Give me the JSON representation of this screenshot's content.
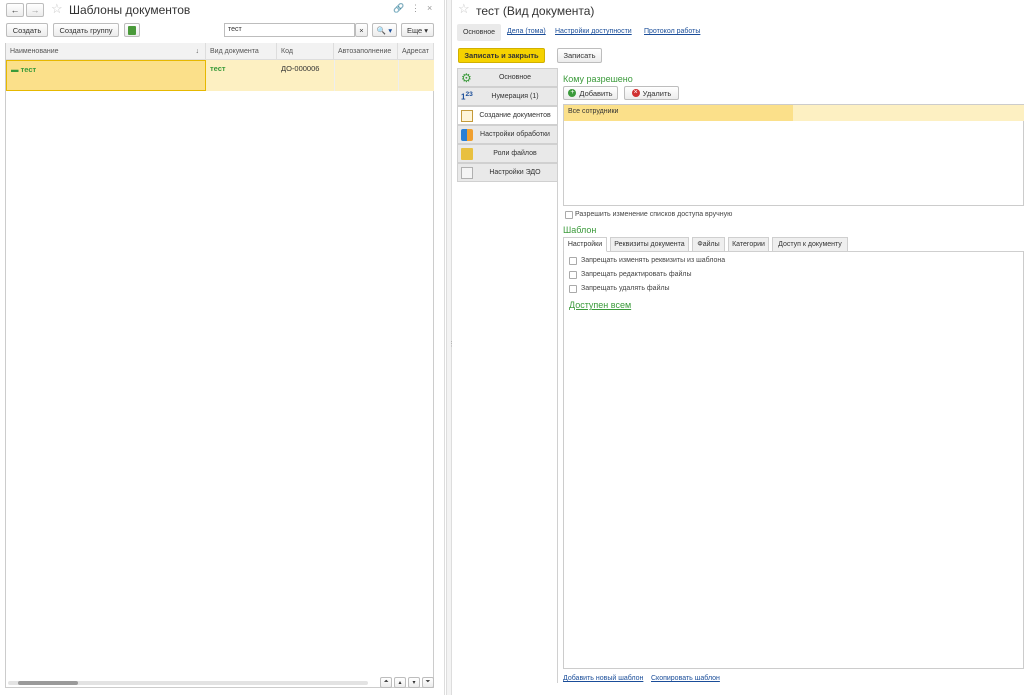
{
  "left": {
    "title": "Шаблоны документов",
    "toolbar": {
      "create": "Создать",
      "create_group": "Создать группу",
      "search_value": "тест",
      "search_clear": "×",
      "search_btn": "🔍 ▾",
      "more": "Еще ▾"
    },
    "table": {
      "columns": [
        "Наименование",
        "Вид документа",
        "Код",
        "Автозаполнение",
        "Адресат"
      ],
      "sort_mark": "↓",
      "rows": [
        {
          "name": "тест",
          "doc_type": "тест",
          "code": "ДО-000006",
          "auto": "",
          "addressee": ""
        }
      ]
    }
  },
  "right": {
    "title": "тест (Вид документа)",
    "nav_tabs": [
      "Основное",
      "Дела (тома)",
      "Настройки доступности",
      "Протокол работы"
    ],
    "buttons": {
      "save_close": "Записать и закрыть",
      "save": "Записать"
    },
    "side_tabs": [
      "Основное",
      "Нумерация (1)",
      "Создание документов",
      "Настройки обработки",
      "Роли файлов",
      "Настройки ЭДО"
    ],
    "access": {
      "heading": "Кому разрешено",
      "add": "Добавить",
      "remove": "Удалить",
      "rows": [
        "Все сотрудники"
      ],
      "manual_change": "Разрешить изменение списков доступа вручную"
    },
    "template": {
      "heading": "Шаблон",
      "tabs": [
        "Настройки",
        "Реквизиты документа",
        "Файлы",
        "Категории",
        "Доступ к документу"
      ],
      "checks": [
        "Запрещать изменять реквизиты из шаблона",
        "Запрещать редактировать файлы",
        "Запрещать удалять файлы"
      ],
      "available": "Доступен всем",
      "add_new": "Добавить новый шаблон",
      "copy": "Скопировать шаблон"
    }
  },
  "colors": {
    "accent_yellow": "#f5d200",
    "row_highlight": "#fbe69a",
    "green": "#3a9a3a",
    "link": "#1a4d99"
  }
}
